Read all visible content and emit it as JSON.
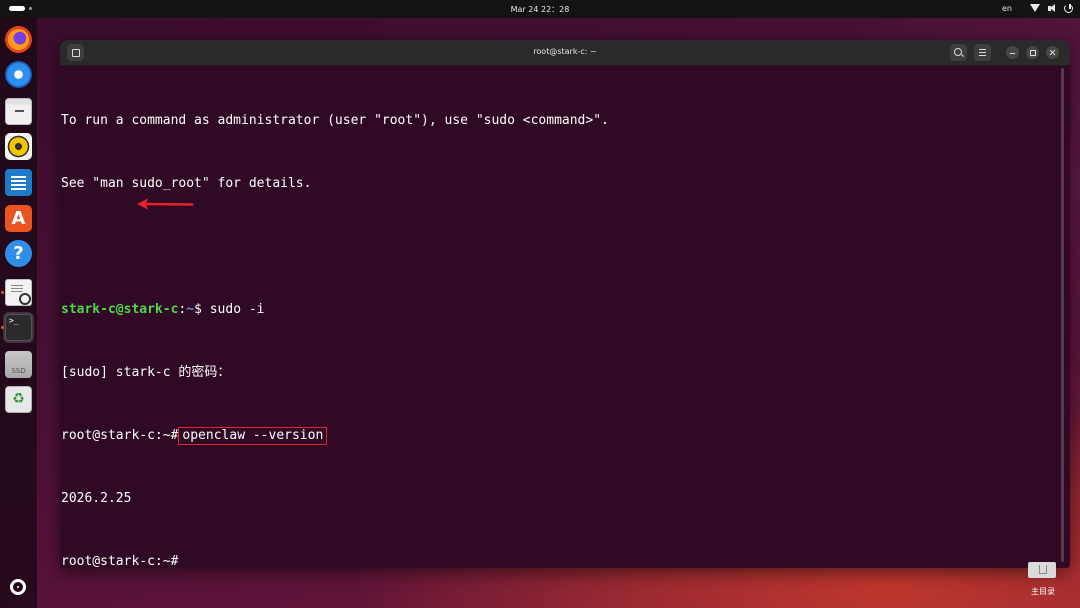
{
  "topbar": {
    "clock": "Mar 24  22：28",
    "language": "en"
  },
  "dock": {
    "apps": [
      {
        "name": "Firefox",
        "icon": "firefox-icon"
      },
      {
        "name": "Thunderbird",
        "icon": "thunderbird-icon"
      },
      {
        "name": "Files",
        "icon": "files-icon"
      },
      {
        "name": "Rhythmbox",
        "icon": "rhythmbox-icon"
      },
      {
        "name": "LibreOffice Writer",
        "icon": "writer-icon"
      },
      {
        "name": "App Center",
        "icon": "app-center-icon"
      },
      {
        "name": "Help",
        "icon": "help-icon"
      },
      {
        "name": "Document Viewer",
        "icon": "document-viewer-icon"
      },
      {
        "name": "Terminal",
        "icon": "terminal-icon",
        "active": true
      },
      {
        "name": "SSD",
        "icon": "ssd-drive-icon",
        "label": "SSD"
      },
      {
        "name": "Trash",
        "icon": "trash-icon"
      },
      {
        "name": "Show Apps",
        "icon": "ubuntu-apps-icon"
      }
    ]
  },
  "window": {
    "title": "root@stark-c: ~"
  },
  "terminal": {
    "line1": "To run a command as administrator (user \"root\"), use \"sudo <command>\".",
    "line2": "See \"man sudo_root\" for details.",
    "prompt_user": "stark-c@stark-c",
    "prompt_sep": ":",
    "prompt_path": "~",
    "prompt_symbol": "$ ",
    "command1": "sudo -i",
    "line4": "[sudo] stark-c 的密码：",
    "root_prompt": "root@stark-c:~#",
    "command2": "openclaw --version",
    "output_version": "2026.2.25",
    "root_prompt_last": "root@stark-c:~#"
  },
  "desktop": {
    "home_label": "主目录"
  },
  "colors": {
    "terminal_bg": "#300a24",
    "prompt_user": "#4fd44a",
    "prompt_path": "#5d8fe0",
    "annotation_red": "#e5232a",
    "ubuntu_orange": "#e95420"
  }
}
